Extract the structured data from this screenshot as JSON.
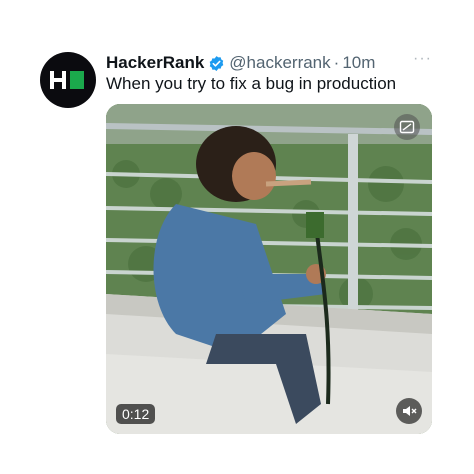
{
  "tweet": {
    "author_name": "HackerRank",
    "handle": "@hackerrank",
    "separator": "·",
    "time": "10m",
    "text": "When you try to fix a bug in production",
    "more_label": "···"
  },
  "media": {
    "duration": "0:12"
  },
  "icons": {
    "avatar": "hackerrank-logo-icon",
    "verified": "verified-badge-icon",
    "pip": "picture-in-picture-icon",
    "mute": "muted-speaker-icon"
  },
  "colors": {
    "verified_blue": "#1d9bf0",
    "logo_green": "#1ba94c",
    "avatar_bg": "#0b0b0f"
  }
}
